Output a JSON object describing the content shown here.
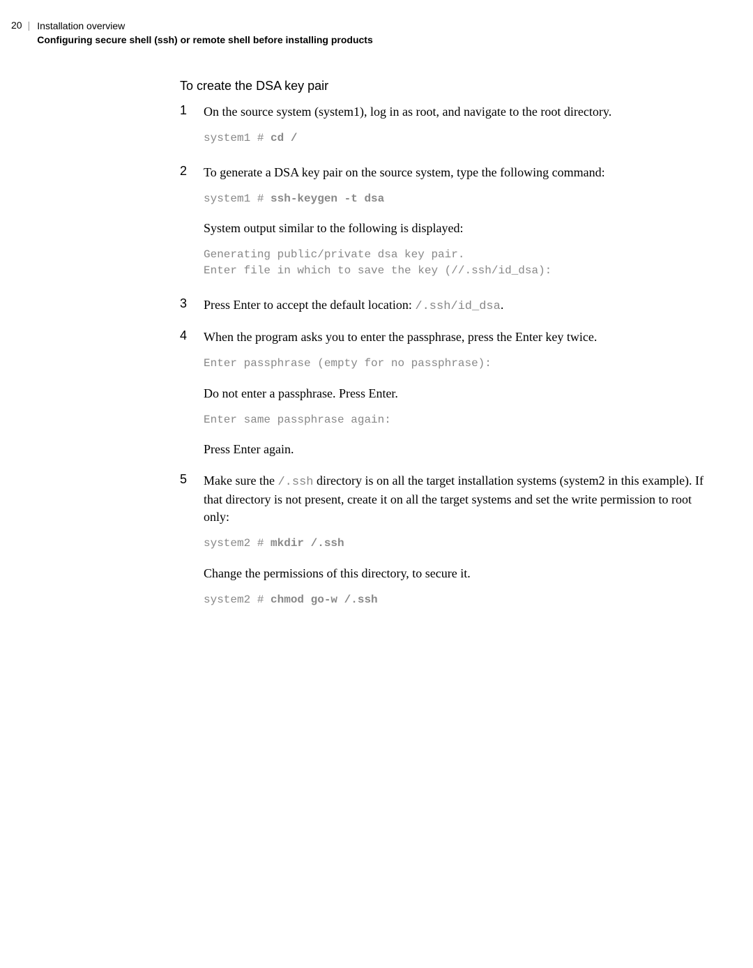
{
  "header": {
    "page_number": "20",
    "line1": "Installation overview",
    "line2": "Configuring secure shell (ssh) or remote shell before installing products"
  },
  "section_title": "To create the DSA key pair",
  "steps": {
    "s1": {
      "num": "1",
      "text": "On the source system (system1), log in as root, and navigate to the root directory.",
      "code_prefix": "system1 # ",
      "code_bold": "cd /"
    },
    "s2": {
      "num": "2",
      "text": "To generate a DSA key pair on the source system, type the following command:",
      "code_prefix": "system1 # ",
      "code_bold": "ssh-keygen -t dsa",
      "text2": "System output similar to the following is displayed:",
      "code2": "Generating public/private dsa key pair.\nEnter file in which to save the key (//.ssh/id_dsa):"
    },
    "s3": {
      "num": "3",
      "text_before": "Press Enter to accept the default location: ",
      "inline_code": "/.ssh/id_dsa",
      "text_after": "."
    },
    "s4": {
      "num": "4",
      "text": "When the program asks you to enter the passphrase, press the Enter key twice.",
      "code1": "Enter passphrase (empty for no passphrase):",
      "text2": "Do not enter a passphrase. Press Enter.",
      "code2": "Enter same passphrase again:",
      "text3": "Press Enter again."
    },
    "s5": {
      "num": "5",
      "text_before": "Make sure the ",
      "inline_code": "/.ssh",
      "text_after": " directory is on all the target installation systems (system2 in this example). If that directory is not present, create it on all the target systems and set the write permission to root only:",
      "code1_prefix": "system2 # ",
      "code1_bold": "mkdir /.ssh",
      "text2": "Change the permissions of this directory, to secure it.",
      "code2_prefix": "system2 # ",
      "code2_bold": "chmod go-w /.ssh"
    }
  }
}
